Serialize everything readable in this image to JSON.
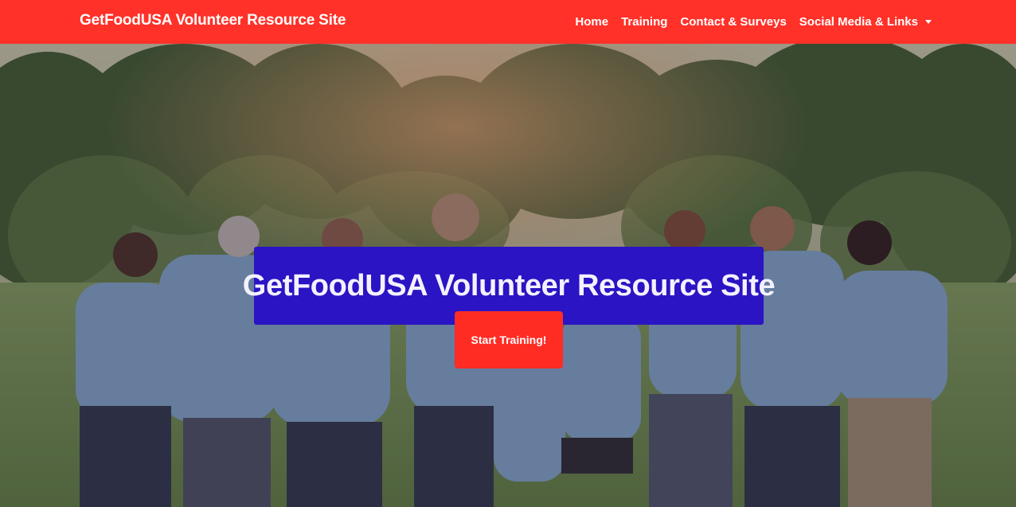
{
  "navbar": {
    "brand": "GetFoodUSA Volunteer Resource Site",
    "links": [
      {
        "label": "Home"
      },
      {
        "label": "Training"
      },
      {
        "label": "Contact & Surveys"
      },
      {
        "label": "Social Media & Links"
      }
    ],
    "color": "#ff3128"
  },
  "hero": {
    "title": "GetFoodUSA Volunteer Resource Site",
    "cta_label": "Start Training!",
    "title_bg": "#2a14c3",
    "cta_bg": "#ff2c24",
    "image": "group-of-volunteers-in-blue-shirts-walking-on-grass-photo"
  }
}
